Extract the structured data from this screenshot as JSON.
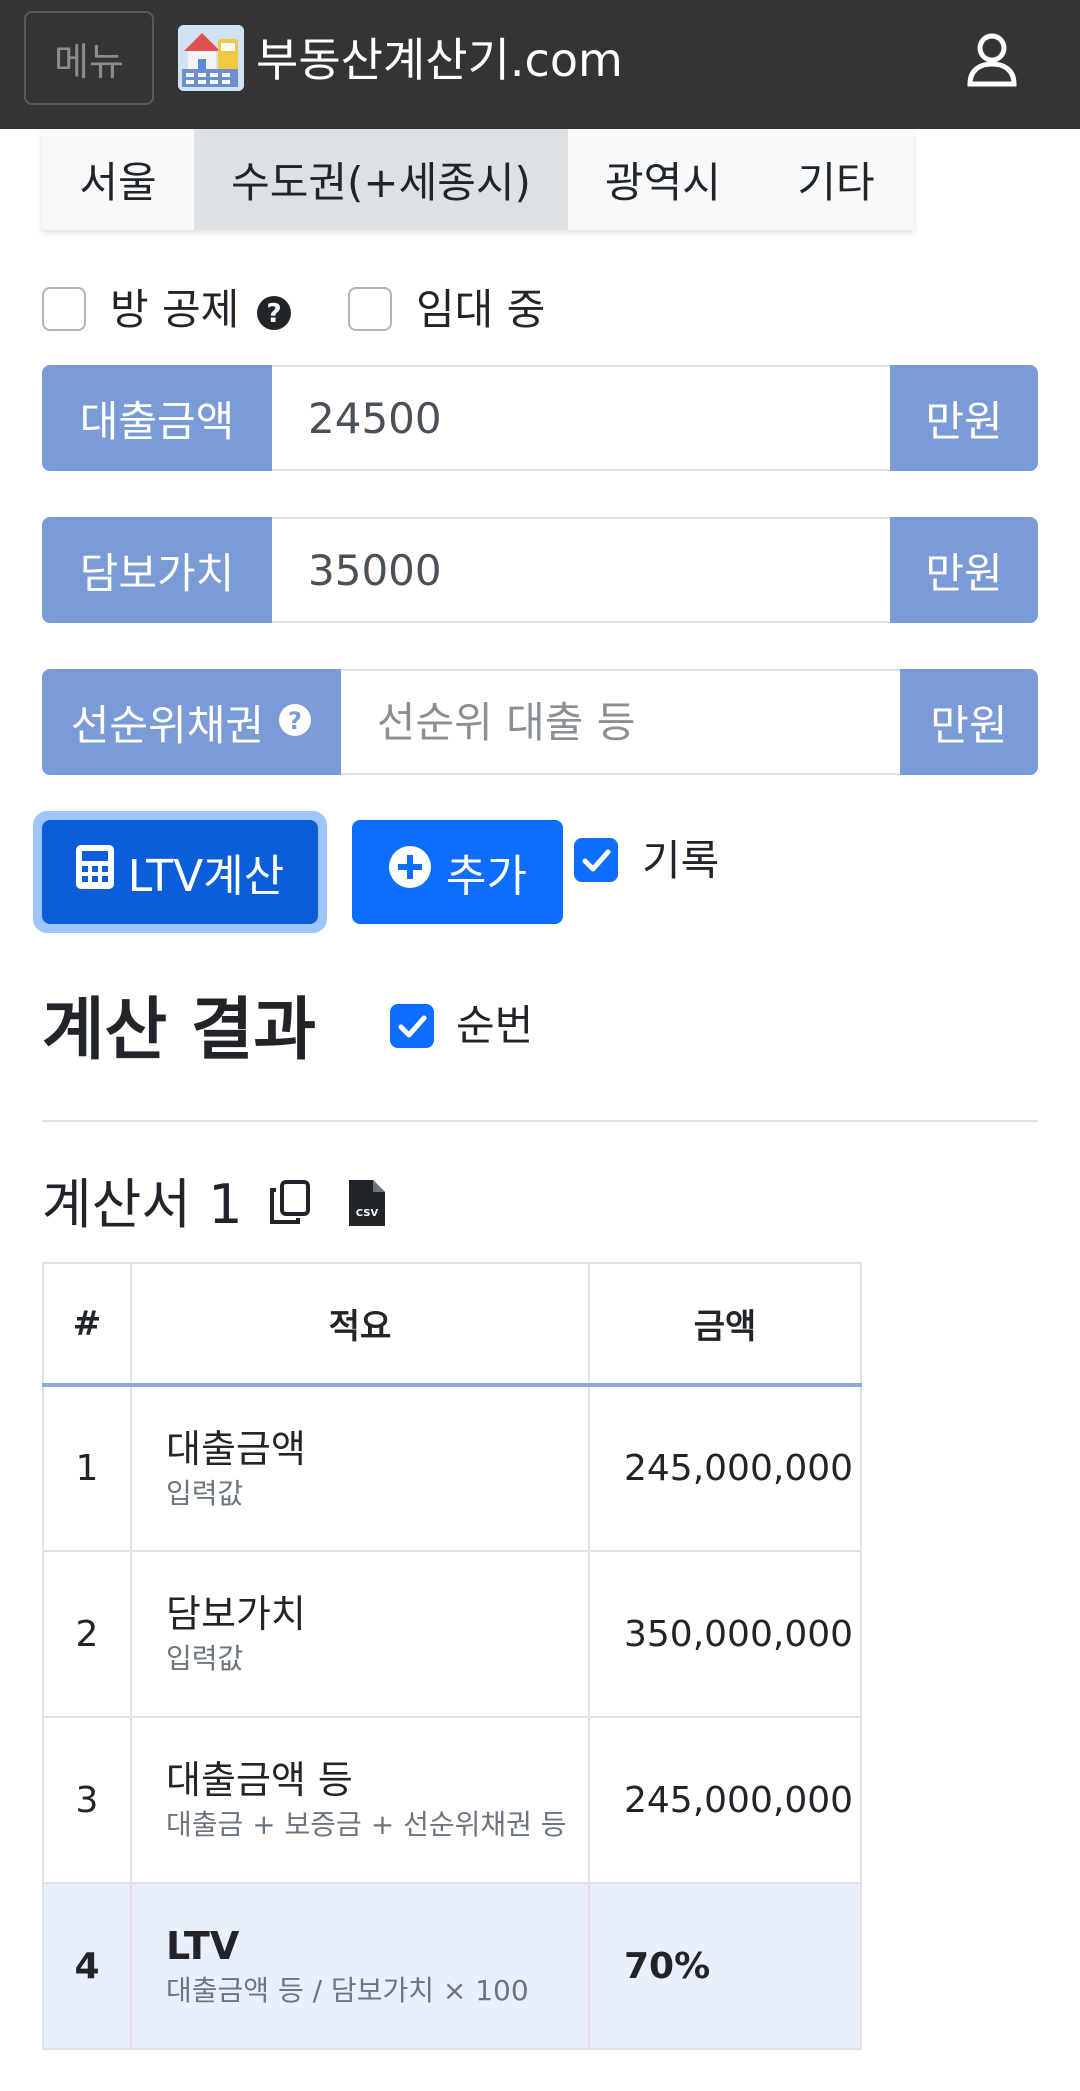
{
  "header": {
    "menu_label": "메뉴",
    "brand": "부동산계산기.com",
    "logo_icon": "house-calculator-logo-icon",
    "user_icon": "user-icon"
  },
  "tabs": [
    {
      "label": "서울",
      "active": false
    },
    {
      "label": "수도권(+세종시)",
      "active": true
    },
    {
      "label": "광역시",
      "active": false
    },
    {
      "label": "기타",
      "active": false
    }
  ],
  "options": {
    "room_deduction_label": "방 공제",
    "room_deduction_checked": false,
    "renting_label": "임대 중",
    "renting_checked": false
  },
  "form": {
    "loan_label": "대출금액",
    "loan_value": "24500",
    "collateral_label": "담보가치",
    "collateral_value": "35000",
    "senior_label": "선순위채권",
    "senior_value": "",
    "senior_placeholder": "선순위 대출 등",
    "unit": "만원"
  },
  "actions": {
    "calc_label": "LTV계산",
    "add_label": "추가",
    "record_label": "기록",
    "record_checked": true
  },
  "result": {
    "title": "계산 결과",
    "order_label": "순번",
    "order_checked": true,
    "sheet_title": "계산서 1"
  },
  "table": {
    "headers": [
      "#",
      "적요",
      "금액"
    ],
    "rows": [
      {
        "num": "1",
        "main": "대출금액",
        "sub": "입력값",
        "amount": "245,000,000"
      },
      {
        "num": "2",
        "main": "담보가치",
        "sub": "입력값",
        "amount": "350,000,000"
      },
      {
        "num": "3",
        "main": "대출금액 등",
        "sub": "대출금 + 보증금 + 선순위채권 등",
        "amount": "245,000,000"
      },
      {
        "num": "4",
        "main": "LTV",
        "sub": "대출금액 등 / 담보가치 × 100",
        "amount": "70%"
      }
    ]
  },
  "colors": {
    "header_bg": "#343434",
    "input_addon": "#7b9bd7",
    "primary": "#0d6efd",
    "highlight_row": "#eaeffd"
  }
}
